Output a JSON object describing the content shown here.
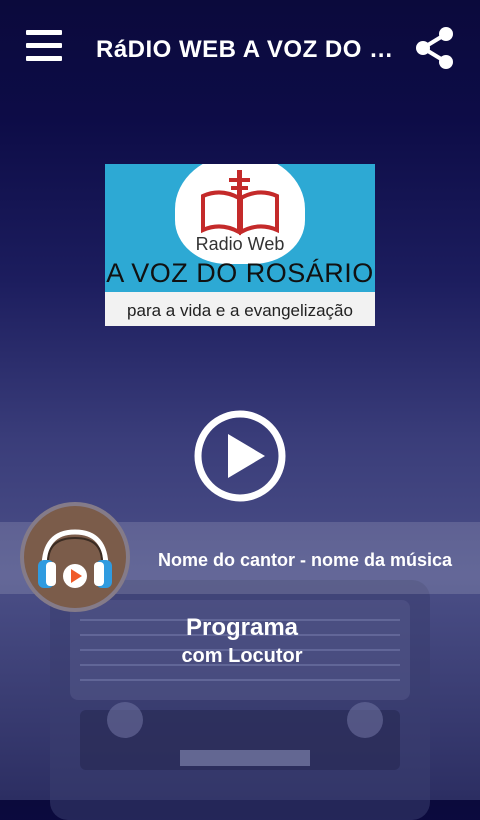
{
  "appbar": {
    "title": "RáDIO WEB A VOZ DO ROSÁRIO",
    "menu_icon": "hamburger-menu-icon",
    "share_icon": "share-icon"
  },
  "logo": {
    "small_text": "Radio Web",
    "big_text": "A VOZ DO ROSÁRIO",
    "tagline": "para a vida e a evangelização"
  },
  "player": {
    "play_icon": "play-icon",
    "track": "Nome do cantor - nome da música",
    "program": "Programa",
    "host": "com Locutor"
  },
  "colors": {
    "appbar_bg": "#0b0a3c",
    "logo_blue": "#2da9d4",
    "book_red": "#c42a2a",
    "avatar_brown": "#7b5c4a",
    "headphone_blue": "#2f9be0",
    "play_orange": "#f05a28"
  }
}
